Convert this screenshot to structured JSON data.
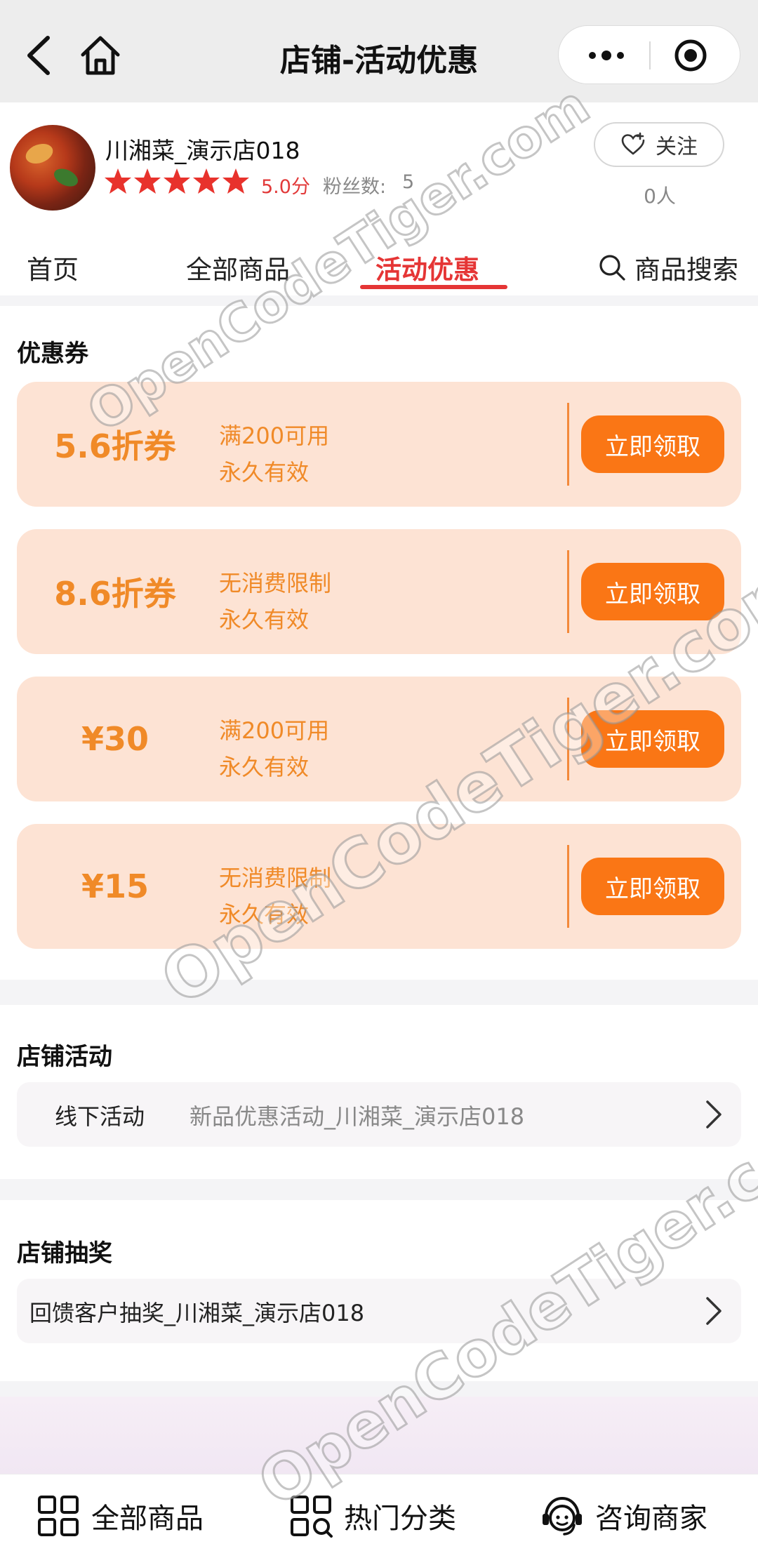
{
  "titlebar": {
    "title": "店铺-活动优惠"
  },
  "shop": {
    "name": "川湘菜_演示店018",
    "rating": 5,
    "score_text": "5.0分",
    "fans_label": "粉丝数:",
    "fans_value": "5",
    "follow_label": "关注",
    "follow_count": "0人"
  },
  "tabs": [
    {
      "label": "首页"
    },
    {
      "label": "全部商品"
    },
    {
      "label": "活动优惠"
    },
    {
      "label": "商品搜索"
    }
  ],
  "coupons": {
    "section_title": "优惠券",
    "items": [
      {
        "amount": "5.6折券",
        "condition": "满200可用",
        "validity": "永久有效",
        "button": "立即领取"
      },
      {
        "amount": "8.6折券",
        "condition": "无消费限制",
        "validity": "永久有效",
        "button": "立即领取"
      },
      {
        "amount": "¥30",
        "condition": "满200可用",
        "validity": "永久有效",
        "button": "立即领取"
      },
      {
        "amount": "¥15",
        "condition": "无消费限制",
        "validity": "永久有效",
        "button": "立即领取"
      }
    ]
  },
  "activity": {
    "section_title": "店铺活动",
    "label": "线下活动",
    "value": "新品优惠活动_川湘菜_演示店018"
  },
  "lottery": {
    "section_title": "店铺抽奖",
    "label": "回馈客户抽奖_川湘菜_演示店018"
  },
  "bottom_nav": [
    {
      "label": "全部商品",
      "icon": "grid-icon"
    },
    {
      "label": "热门分类",
      "icon": "category-search-icon"
    },
    {
      "label": "咨询商家",
      "icon": "customer-service-icon"
    }
  ],
  "watermark": "OpenCodeTiger.com",
  "colors": {
    "accent_red": "#e53535",
    "coupon_bg": "#fde3d4",
    "coupon_text": "#f08a28",
    "button_orange": "#fa7615",
    "star_red": "#e8322c"
  }
}
